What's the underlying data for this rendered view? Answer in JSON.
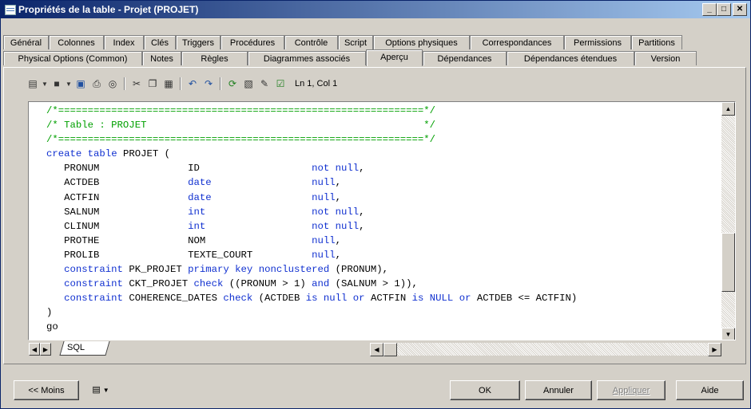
{
  "window": {
    "title": "Propriétés de la table - Projet (PROJET)"
  },
  "title_buttons": {
    "minimize": "_",
    "maximize": "□",
    "close": "✕"
  },
  "tabs_row1": [
    "Général",
    "Colonnes",
    "Index",
    "Clés",
    "Triggers",
    "Procédures",
    "Contrôle",
    "Script",
    "Options physiques",
    "Correspondances",
    "Permissions",
    "Partitions"
  ],
  "tabs_row2": [
    "Physical Options (Common)",
    "Notes",
    "Règles",
    "Diagrammes associés",
    "Aperçu",
    "Dépendances",
    "Dépendances étendues",
    "Version"
  ],
  "active_tab": "Aperçu",
  "toolbar": {
    "icons": [
      "properties-icon",
      "new-icon",
      "save-icon",
      "print-icon",
      "find-icon",
      "cut-icon",
      "copy-icon",
      "paste-icon",
      "undo-icon",
      "redo-icon",
      "refresh-icon",
      "editor-icon",
      "edit-icon",
      "check-icon"
    ],
    "position": "Ln 1, Col 1"
  },
  "editor": {
    "lines": [
      "/*==============================================================*/",
      "/* Table : PROJET                                               */",
      "/*==============================================================*/",
      "create table PROJET (",
      "   PRONUM               ID                   not null,",
      "   ACTDEB               date                 null,",
      "   ACTFIN               date                 null,",
      "   SALNUM               int                  not null,",
      "   CLINUM               int                  not null,",
      "   PROTHE               NOM                  null,",
      "   PROLIB               TEXTE_COURT          null,",
      "   constraint PK_PROJET primary key nonclustered (PRONUM),",
      "   constraint CKT_PROJET check ((PRONUM > 1) and (SALNUM > 1)),",
      "   constraint COHERENCE_DATES check (ACTDEB is null or ACTFIN is NULL or ACTDEB <= ACTFIN)",
      ")",
      "go"
    ],
    "sheet_tab": "SQL"
  },
  "footer": {
    "less_button": "<< Moins",
    "ok_button": "OK",
    "cancel_button": "Annuler",
    "apply_button": "Appliquer",
    "help_button": "Aide"
  },
  "colors": {
    "comment": "#00a000",
    "keyword": "#1030d0",
    "titlebar_start": "#0a246a",
    "titlebar_end": "#a6caf0"
  }
}
